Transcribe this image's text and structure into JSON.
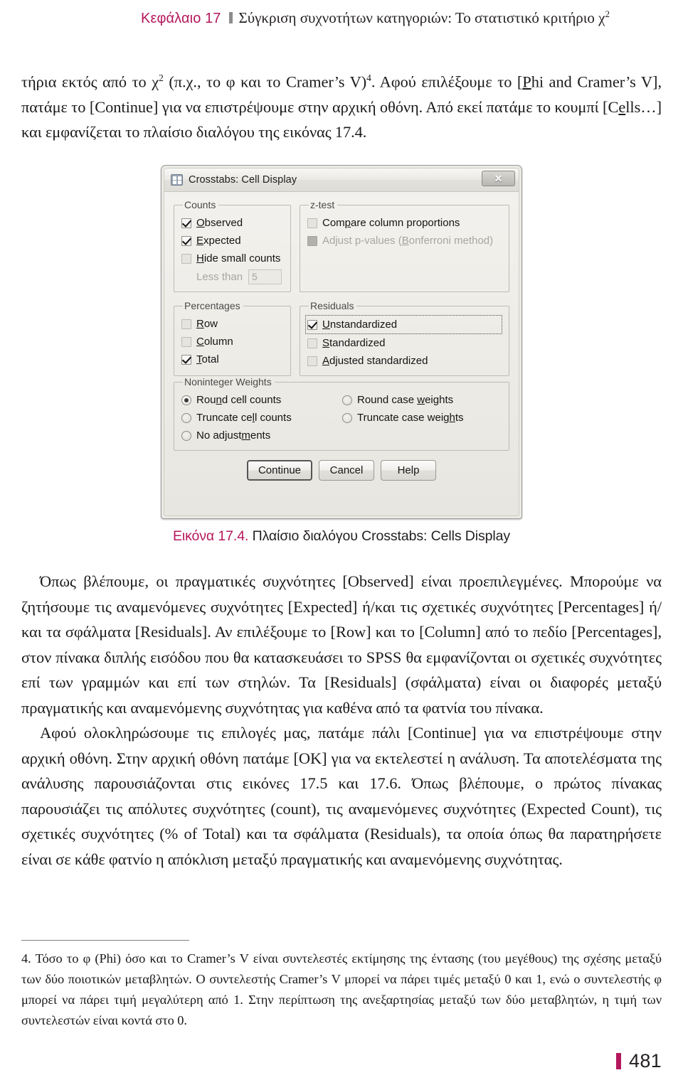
{
  "running_head": {
    "chapter": "Κεφάλαιο 17",
    "title_before_sup": "Σύγκριση συχνοτήτων κατηγοριών: Το στατιστικό κριτήριο χ",
    "title_sup": "2"
  },
  "body_top": {
    "para1_a": "τήρια εκτός από το χ",
    "para1_sup1": "2",
    "para1_b": " (π.χ., το φ και το Cramer’s V)",
    "para1_sup2": "4",
    "para1_c": ". Αφού επιλέξουμε το [",
    "para1_u1": "P",
    "para1_d": "hi and Cramer’s V], πατάμε το [Continue]  για να επιστρέψουμε στην αρχική οθόνη. Από εκεί πατάμε το κουμπί [C",
    "para1_u2": "e",
    "para1_e": "lls…] και εμφανίζεται το πλαίσιο διαλόγου της εικόνας 17.4."
  },
  "dialog": {
    "title": "Crosstabs: Cell Display",
    "title_icon": "spss-app-icon",
    "close_label": "✕",
    "close_icon": "close-icon",
    "groups": {
      "counts": {
        "legend": "Counts",
        "options": [
          {
            "label": "Observed",
            "mnemonic": "O",
            "checked": true,
            "disabled": false
          },
          {
            "label": "Expected",
            "mnemonic": "E",
            "checked": true,
            "disabled": false
          },
          {
            "label": "Hide small counts",
            "mnemonic": "H",
            "checked": false,
            "disabled": false
          }
        ],
        "less_than_label": "Less than",
        "less_than_value": "5"
      },
      "ztest": {
        "legend": "z-test",
        "options": [
          {
            "label": "Compare column proportions",
            "mnemonic": "p",
            "checked": false,
            "disabled": false
          },
          {
            "label": "Adjust p-values (Bonferroni method)",
            "mnemonic": "B",
            "checked": false,
            "disabled": true
          }
        ]
      },
      "percentages": {
        "legend": "Percentages",
        "options": [
          {
            "label": "Row",
            "mnemonic": "R",
            "checked": false
          },
          {
            "label": "Column",
            "mnemonic": "C",
            "checked": false
          },
          {
            "label": "Total",
            "mnemonic": "T",
            "checked": true
          }
        ]
      },
      "residuals": {
        "legend": "Residuals",
        "options": [
          {
            "label": "Unstandardized",
            "mnemonic": "U",
            "checked": true,
            "focused": true
          },
          {
            "label": "Standardized",
            "mnemonic": "S",
            "checked": false,
            "focused": false
          },
          {
            "label": "Adjusted standardized",
            "mnemonic": "A",
            "checked": false,
            "focused": false
          }
        ]
      },
      "noninteger_weights": {
        "legend": "Noninteger Weights",
        "options": [
          {
            "label": "Round cell counts",
            "selected": true
          },
          {
            "label": "Round case weights",
            "selected": false
          },
          {
            "label": "Truncate cell counts",
            "selected": false
          },
          {
            "label": "Truncate case weights",
            "selected": false
          },
          {
            "label": "No adjustments",
            "selected": false
          }
        ]
      }
    },
    "buttons": [
      {
        "label": "Continue",
        "default": true
      },
      {
        "label": "Cancel",
        "default": false
      },
      {
        "label": "Help",
        "default": false
      }
    ]
  },
  "figure_caption": {
    "number": "Εικόνα 17.4.",
    "text": " Πλαίσιο διαλόγου Crosstabs: Cells Display"
  },
  "body_lower": {
    "para2": "Όπως βλέπουμε, οι πραγματικές συχνότητες [Observed] είναι προεπιλεγμένες. Μπορούμε να ζητήσουμε τις αναμενόμενες συχνότητες [Expected] ή/και τις σχετικές συχνότητες [Percentages] ή/και τα σφάλματα [Residuals]. Αν επιλέξουμε το [Row] και το [Column] από το πεδίο [Percentages], στον πίνακα διπλής εισόδου που θα κατασκευάσει το SPSS θα εμφανίζονται οι σχετικές συχνότητες επί των γραμμών και επί των στηλών. Τα [Residuals] (σφάλματα) είναι οι διαφορές μεταξύ πραγματικής και αναμενόμενης συχνότητας για καθένα από τα φατνία του πίνακα.",
    "para3": "Αφού ολοκληρώσουμε τις επιλογές μας, πατάμε πάλι [Continue] για να επιστρέψουμε στην αρχική οθόνη. Στην αρχική οθόνη πατάμε [ΟΚ] για να εκτελεστεί η ανάλυση. Τα αποτελέσματα της ανάλυσης παρουσιάζονται στις εικόνες 17.5 και 17.6. Όπως βλέπουμε, ο πρώτος πίνακας παρουσιάζει τις απόλυτες συχνότητες (count), τις αναμενόμενες συχνότητες (Expected Count), τις σχετικές συχνότητες (% of Total) και τα σφάλματα (Residuals), τα οποία όπως θα παρατηρήσετε είναι σε κάθε φατνίο η απόκλιση μεταξύ πραγματικής και αναμενόμενης συχνότητας."
  },
  "footnote": {
    "text": "4. Τόσο το φ (Phi) όσο και το Cramer’s V είναι συντελεστές εκτίμησης της έντασης (του μεγέθους) της σχέσης μεταξύ των δύο ποιοτικών μεταβλητών. Ο συντελεστής Cramer’s V μπορεί να πάρει τιμές μεταξύ 0 και 1, ενώ ο συντελεστής φ μπορεί να πάρει τιμή μεγαλύτερη από 1. Στην περίπτωση της ανεξαρτησίας μεταξύ των δύο μεταβλητών, η τιμή των συντελεστών είναι κοντά στο 0."
  },
  "folio": {
    "page_number": "481"
  },
  "colors": {
    "accent": "#b4185c",
    "text": "#231f20",
    "dialog_bg": "#eceae4"
  }
}
